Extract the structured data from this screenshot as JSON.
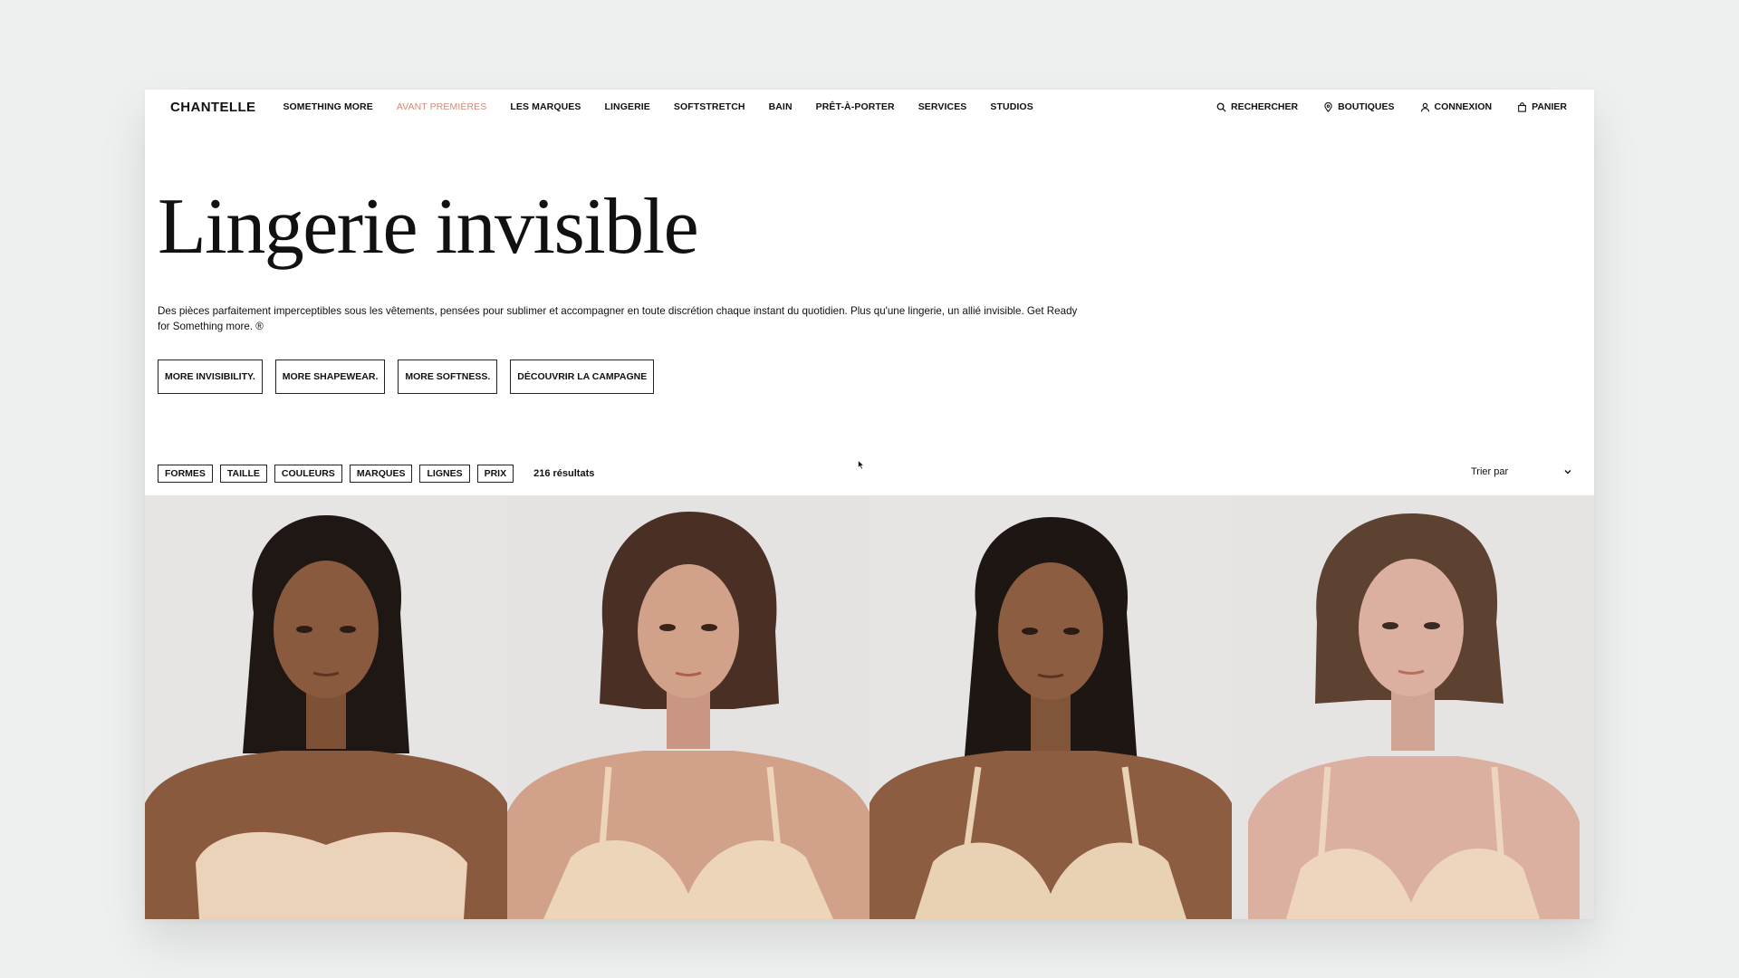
{
  "brand": {
    "logo": "CHANTELLE"
  },
  "nav": [
    {
      "label": "SOMETHING MORE",
      "accent": false
    },
    {
      "label": "AVANT PREMIÈRES",
      "accent": true
    },
    {
      "label": "LES MARQUES",
      "accent": false
    },
    {
      "label": "LINGERIE",
      "accent": false
    },
    {
      "label": "SOFTSTRETCH",
      "accent": false
    },
    {
      "label": "BAIN",
      "accent": false
    },
    {
      "label": "PRÊT-À-PORTER",
      "accent": false
    },
    {
      "label": "SERVICES",
      "accent": false
    },
    {
      "label": "STUDIOS",
      "accent": false
    }
  ],
  "utilities": {
    "search": {
      "label": "RECHERCHER",
      "icon": "search-icon"
    },
    "stores": {
      "label": "BOUTIQUES",
      "icon": "location-pin-icon"
    },
    "account": {
      "label": "CONNEXION",
      "icon": "user-icon"
    },
    "cart": {
      "label": "PANIER",
      "icon": "bag-icon"
    }
  },
  "hero": {
    "title": "Lingerie invisible",
    "description_line1": "Des pièces parfaitement imperceptibles sous les vêtements, pensées pour sublimer et accompagner en toute discrétion chaque instant du quotidien. Plus qu'une lingerie, un allié invisible. Get Ready",
    "description_line2": "for Something more. ®"
  },
  "ctas": [
    "MORE INVISIBILITY.",
    "MORE SHAPEWEAR.",
    "MORE SOFTNESS.",
    "DÉCOUVRIR LA CAMPAGNE"
  ],
  "filters": [
    "FORMES",
    "TAILLE",
    "COULEURS",
    "MARQUES",
    "LIGNES",
    "PRIX"
  ],
  "results": "216 résultats",
  "sort": {
    "label": "Trier par",
    "icon": "chevron-down-icon"
  },
  "products": [
    {
      "alt": "model-1-strapless-bra",
      "skin": "#8a5a3e",
      "hair": "#1e1714",
      "bra": "#ead3b8"
    },
    {
      "alt": "model-2-tshirt-bra",
      "skin": "#d2a18a",
      "hair": "#4a3024",
      "bra": "#ecd5b9"
    },
    {
      "alt": "model-3-tshirt-bra",
      "skin": "#8d5d41",
      "hair": "#1d1613",
      "bra": "#e9d1b4"
    },
    {
      "alt": "model-4-tshirt-bra",
      "skin": "#dcb0a0",
      "hair": "#5d4232",
      "bra": "#edd6bd"
    }
  ],
  "colors": {
    "accent": "#d08a77",
    "background": "#eeefef",
    "photo_bg": "#e4e3e1"
  }
}
